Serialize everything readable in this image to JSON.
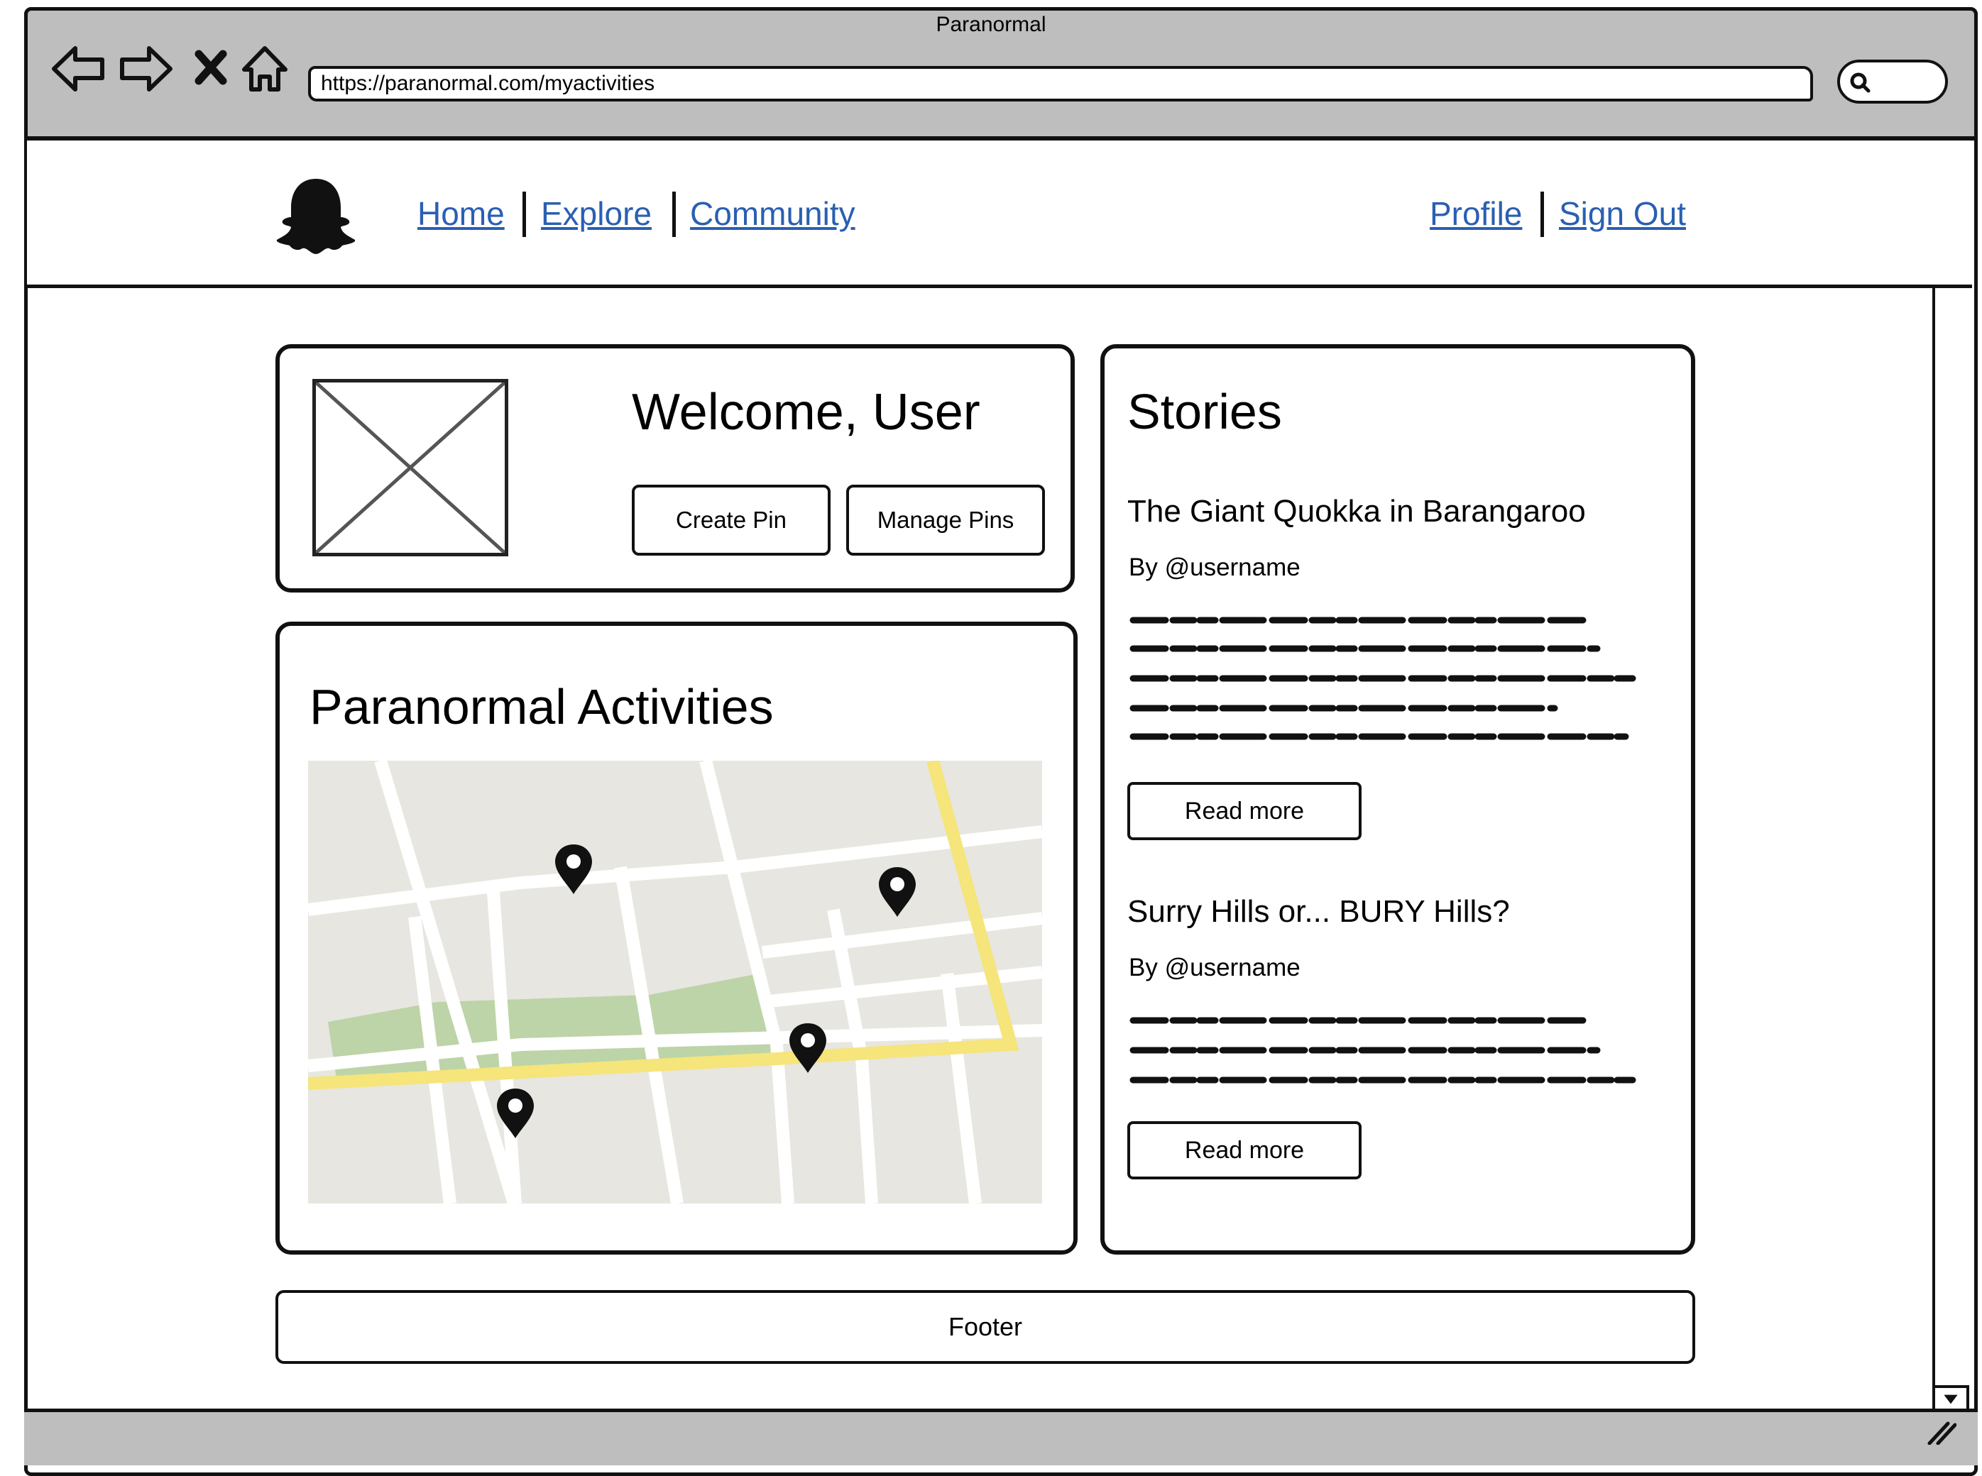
{
  "window": {
    "title": "Paranormal"
  },
  "browser": {
    "url": "https://paranormal.com/myactivities",
    "icons": [
      "back-arrow-icon",
      "forward-arrow-icon",
      "stop-icon",
      "home-icon",
      "search-icon"
    ]
  },
  "nav": {
    "logo_icon": "ghost-icon",
    "left_links": [
      "Home",
      "Explore",
      "Community"
    ],
    "right_links": [
      "Profile",
      "Sign Out"
    ]
  },
  "welcome": {
    "title": "Welcome, User",
    "avatar_icon": "image-placeholder-icon",
    "buttons": [
      "Create Pin",
      "Manage Pins"
    ]
  },
  "activities": {
    "title": "Paranormal Activities",
    "map_icon": "map-pin-icon",
    "colors": {
      "road_major": "#f5e57a",
      "park": "#bcd4a7",
      "block": "#e7e6e0",
      "road_minor": "#ffffff"
    }
  },
  "stories": {
    "title": "Stories",
    "items": [
      {
        "title": "The Giant Quokka in Barangaroo",
        "byline": "By @username",
        "button": "Read more"
      },
      {
        "title": "Surry Hills or... BURY Hills?",
        "byline": "By @username",
        "button": "Read more"
      }
    ]
  },
  "footer": {
    "label": "Footer"
  },
  "colors": {
    "link": "#2a5fb2",
    "chrome": "#bebebe",
    "border": "#111111"
  }
}
